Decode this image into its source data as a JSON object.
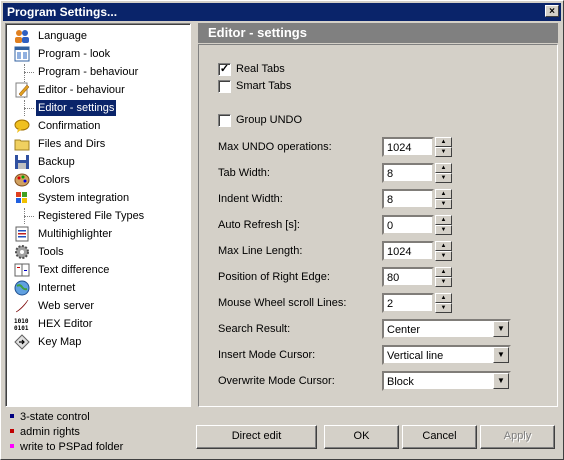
{
  "window": {
    "title": "Program Settings...",
    "close_glyph": "×"
  },
  "tree": {
    "items": [
      {
        "label": "Language",
        "icon": "people-icon"
      },
      {
        "label": "Program - look",
        "icon": "window-layout-icon"
      },
      {
        "label": "Program - behaviour",
        "icon": ""
      },
      {
        "label": "Editor - behaviour",
        "icon": "pencil-page-icon"
      },
      {
        "label": "Editor - settings",
        "icon": "",
        "selected": true
      },
      {
        "label": "Confirmation",
        "icon": "speech-bubble-icon"
      },
      {
        "label": "Files and Dirs",
        "icon": "folder-icon"
      },
      {
        "label": "Backup",
        "icon": "floppy-disk-icon"
      },
      {
        "label": "Colors",
        "icon": "palette-icon"
      },
      {
        "label": "System integration",
        "icon": "windows-flag-icon"
      },
      {
        "label": "Registered File Types",
        "icon": ""
      },
      {
        "label": "Multihighlighter",
        "icon": "list-document-icon"
      },
      {
        "label": "Tools",
        "icon": "gear-icon"
      },
      {
        "label": "Text difference",
        "icon": "compare-document-icon"
      },
      {
        "label": "Internet",
        "icon": "globe-icon"
      },
      {
        "label": "Web server",
        "icon": "feather-icon"
      },
      {
        "label": "HEX Editor",
        "icon": "binary-icon"
      },
      {
        "label": "Key Map",
        "icon": "diamond-arrow-icon"
      }
    ]
  },
  "legend": {
    "items": [
      {
        "label": "3-state control",
        "color": "#000080"
      },
      {
        "label": "admin rights",
        "color": "#c00000"
      },
      {
        "label": "write to PSPad folder",
        "color": "#ff00ff"
      }
    ]
  },
  "panel": {
    "title": "Editor - settings",
    "checkboxes": [
      {
        "label": "Real Tabs",
        "checked": true
      },
      {
        "label": "Smart Tabs",
        "checked": false
      },
      {
        "label": "Group UNDO",
        "checked": false
      }
    ],
    "spin_fields": [
      {
        "label": "Max UNDO operations:",
        "value": "1024"
      },
      {
        "label": "Tab Width:",
        "value": "8"
      },
      {
        "label": "Indent Width:",
        "value": "8"
      },
      {
        "label": "Auto Refresh [s]:",
        "value": "0"
      },
      {
        "label": "Max Line Length:",
        "value": "1024"
      },
      {
        "label": "Position of Right Edge:",
        "value": "80"
      },
      {
        "label": "Mouse Wheel scroll Lines:",
        "value": "2"
      }
    ],
    "select_fields": [
      {
        "label": "Search Result:",
        "value": "Center"
      },
      {
        "label": "Insert Mode Cursor:",
        "value": "Vertical line"
      },
      {
        "label": "Overwrite Mode Cursor:",
        "value": "Block"
      }
    ]
  },
  "buttons": {
    "direct_edit": "Direct edit",
    "ok": "OK",
    "cancel": "Cancel",
    "apply": "Apply"
  }
}
